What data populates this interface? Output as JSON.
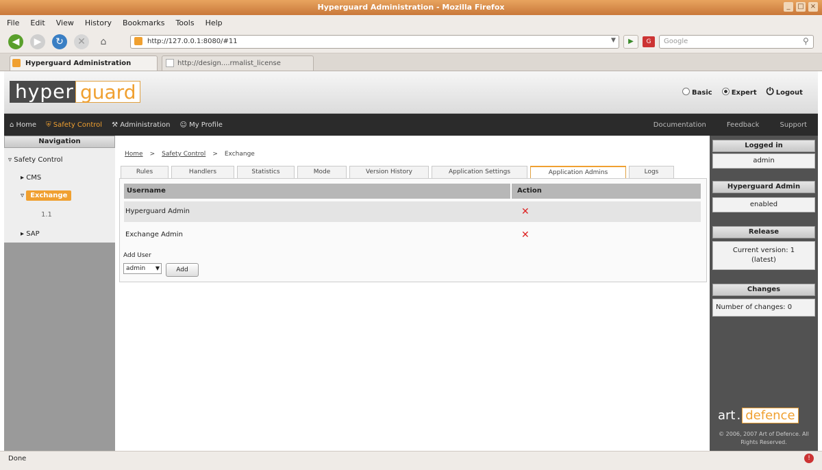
{
  "window": {
    "title": "Hyperguard Administration - Mozilla Firefox"
  },
  "menu": [
    "File",
    "Edit",
    "View",
    "History",
    "Bookmarks",
    "Tools",
    "Help"
  ],
  "browser": {
    "url": "http://127.0.0.1:8080/#11",
    "search_placeholder": "Google"
  },
  "tabs": [
    {
      "label": "Hyperguard Administration"
    },
    {
      "label": "http://design....rmalist_license"
    }
  ],
  "header": {
    "logo_left": "hyper",
    "logo_right": "guard",
    "mode_basic": "Basic",
    "mode_expert": "Expert",
    "logout": "Logout"
  },
  "mainnav": {
    "left": [
      "Home",
      "Safety Control",
      "Administration",
      "My Profile"
    ],
    "right": [
      "Documentation",
      "Feedback",
      "Support"
    ]
  },
  "sidebar": {
    "title": "Navigation",
    "items": {
      "root": "Safety Control",
      "c1": "CMS",
      "c2": "Exchange",
      "c2a": "1.1",
      "c3": "SAP"
    }
  },
  "breadcrumb": [
    "Home",
    "Safety Control",
    "Exchange"
  ],
  "content_tabs": [
    "Rules",
    "Handlers",
    "Statistics",
    "Mode",
    "Version History",
    "Application Settings",
    "Application Admins",
    "Logs"
  ],
  "table": {
    "headers": [
      "Username",
      "Action"
    ],
    "rows": [
      {
        "name": "Hyperguard Admin"
      },
      {
        "name": "Exchange Admin"
      }
    ]
  },
  "form": {
    "label": "Add User",
    "select_value": "admin",
    "button": "Add"
  },
  "right": {
    "logged_in_title": "Logged in",
    "logged_in_value": "admin",
    "hg_admin_title": "Hyperguard Admin",
    "hg_admin_value": "enabled",
    "release_title": "Release",
    "release_value": "Current version: 1 (latest)",
    "changes_title": "Changes",
    "changes_value": "Number of changes: 0",
    "brand_left": "art",
    "brand_right": "defence",
    "copyright": "© 2006, 2007 Art of Defence. All Rights Reserved."
  },
  "status": {
    "text": "Done"
  }
}
